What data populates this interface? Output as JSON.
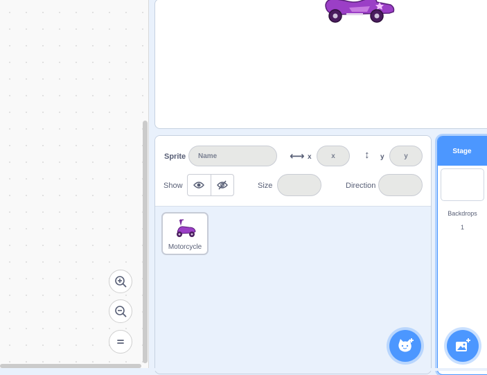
{
  "sprite_info": {
    "sprite_label": "Sprite",
    "name_placeholder": "Name",
    "x_label": "x",
    "x_placeholder": "x",
    "y_label": "y",
    "y_placeholder": "y",
    "show_label": "Show",
    "size_label": "Size",
    "direction_label": "Direction"
  },
  "sprites": [
    {
      "name": "Motorcycle"
    }
  ],
  "stage_pane": {
    "title": "Stage",
    "backdrops_label": "Backdrops",
    "backdrops_count": "1"
  },
  "icons": {
    "zoom_in": "zoom-in-icon",
    "zoom_out": "zoom-out-icon",
    "zoom_reset": "zoom-reset-icon",
    "show": "eye-icon",
    "hide": "eye-slash-icon",
    "add_sprite": "cat-add-icon",
    "add_backdrop": "image-add-icon",
    "x_axis": "horizontal-arrows-icon",
    "y_axis": "vertical-arrows-icon"
  },
  "colors": {
    "accent": "#4c97ff",
    "sprite_purple": "#9b3fc6"
  }
}
